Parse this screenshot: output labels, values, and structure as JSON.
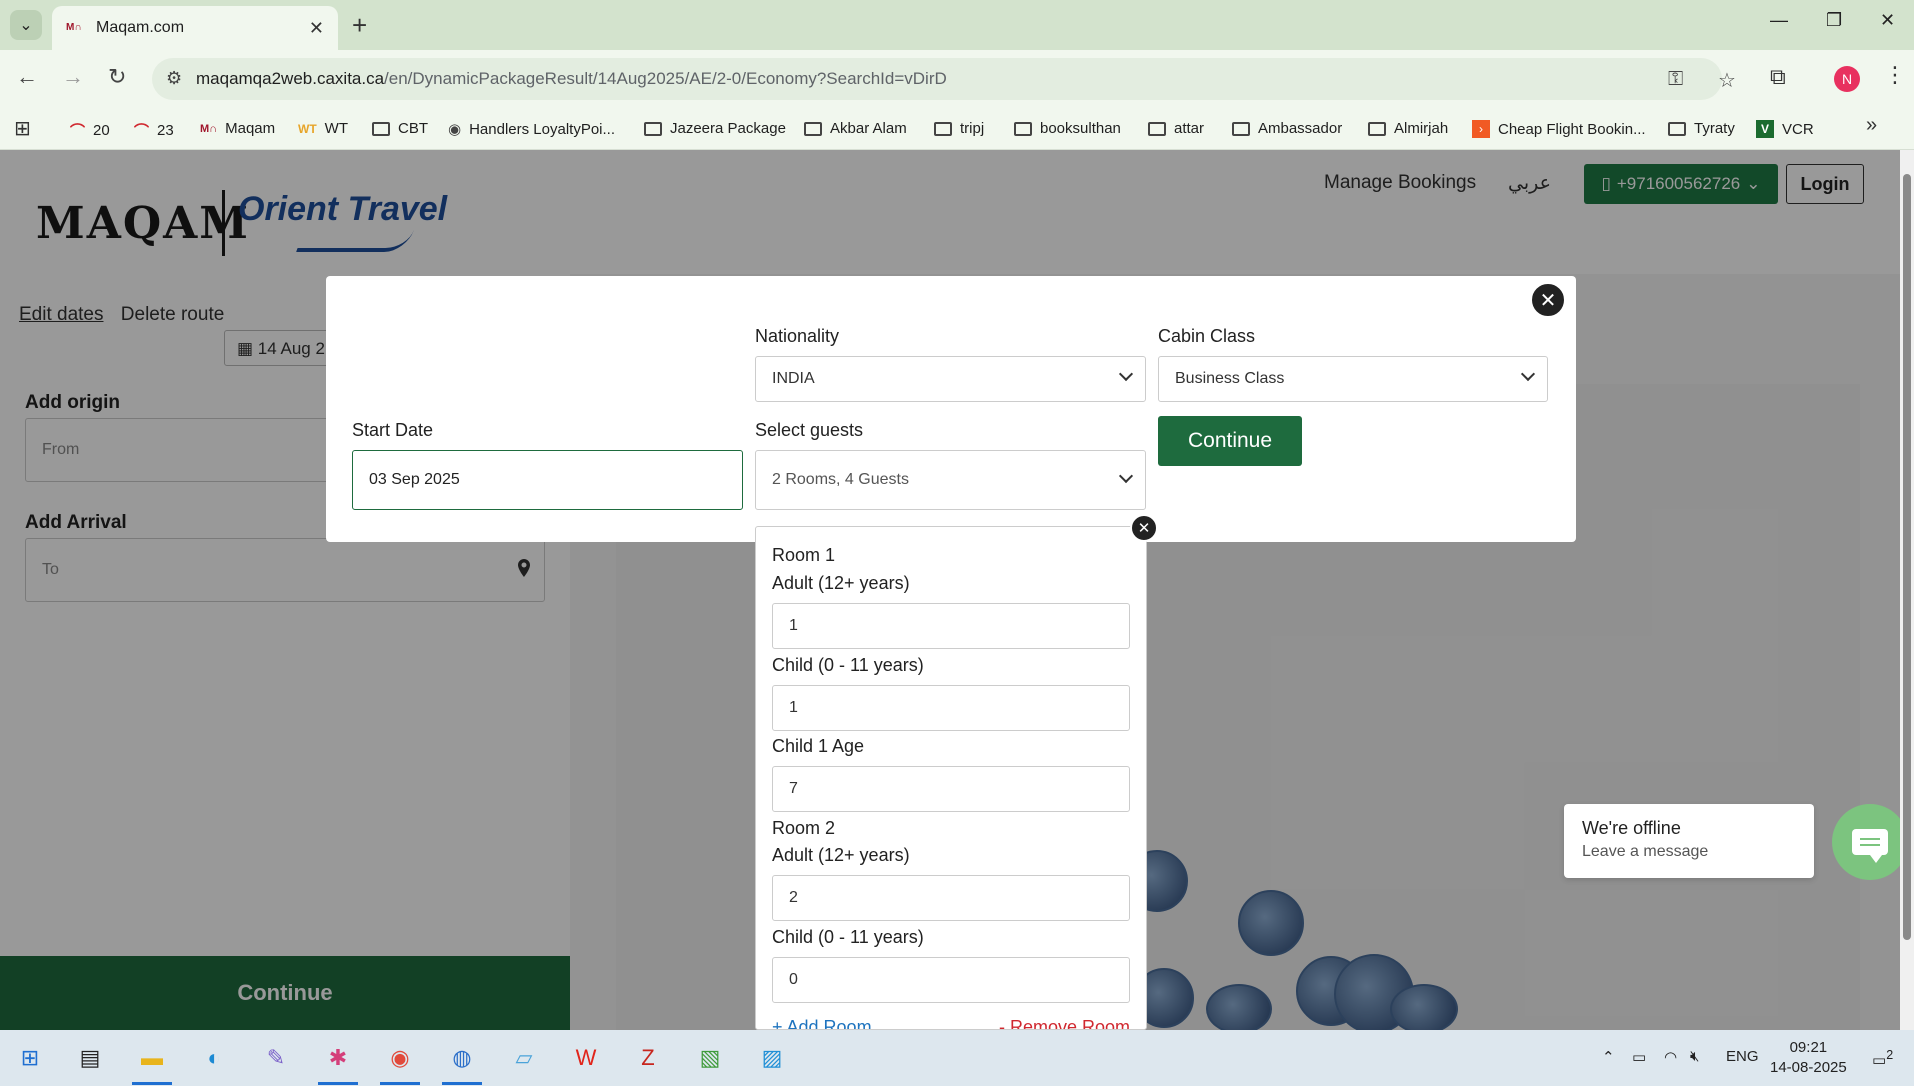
{
  "browser": {
    "tab_title": "Maqam.com",
    "url_host": "maqamqa2web.caxita.ca",
    "url_path": "/en/DynamicPackageResult/14Aug2025/AE/2-0/Economy?SearchId=vDirD",
    "bookmarks": [
      {
        "label": "20",
        "icon": "gauge-icon"
      },
      {
        "label": "23",
        "icon": "gauge-icon"
      },
      {
        "label": "Maqam",
        "icon": "maqam-icon"
      },
      {
        "label": "WT",
        "icon": "wt-icon"
      },
      {
        "label": "CBT",
        "icon": "folder-icon"
      },
      {
        "label": "Handlers LoyaltyPoi...",
        "icon": "globe-icon"
      },
      {
        "label": "Jazeera Package",
        "icon": "folder-icon"
      },
      {
        "label": "Akbar Alam",
        "icon": "folder-icon"
      },
      {
        "label": "tripj",
        "icon": "folder-icon"
      },
      {
        "label": "booksulthan",
        "icon": "folder-icon"
      },
      {
        "label": "attar",
        "icon": "folder-icon"
      },
      {
        "label": "Ambassador",
        "icon": "folder-icon"
      },
      {
        "label": "Almirjah",
        "icon": "folder-icon"
      },
      {
        "label": "Cheap Flight Bookin...",
        "icon": "flight-icon"
      },
      {
        "label": "Tyraty",
        "icon": "folder-icon"
      },
      {
        "label": "VCR",
        "icon": "vcr-icon"
      }
    ],
    "profile_initial": "N"
  },
  "header": {
    "logo_maqam": "MAQAM",
    "logo_orient": "Orient Travel",
    "manage_bookings": "Manage Bookings",
    "arabic": "عربي",
    "phone": "+971600562726",
    "login": "Login"
  },
  "left_panel": {
    "edit_dates": "Edit dates",
    "delete_route": "Delete route",
    "date_chip": "14 Aug 2",
    "add_origin": "Add origin",
    "from_placeholder": "From",
    "add_arrival": "Add Arrival",
    "to_placeholder": "To",
    "continue": "Continue"
  },
  "modal": {
    "nationality_label": "Nationality",
    "nationality_value": "INDIA",
    "cabin_label": "Cabin Class",
    "cabin_value": "Business Class",
    "start_date_label": "Start Date",
    "start_date_value": "03 Sep 2025",
    "guests_label": "Select guests",
    "guests_value": "2 Rooms, 4 Guests",
    "continue": "Continue"
  },
  "guests": {
    "room1": {
      "title": "Room 1",
      "adult_label": "Adult (12+ years)",
      "adult_value": "1",
      "child_label": "Child (0 - 11 years)",
      "child_value": "1",
      "child1_age_label": "Child 1 Age",
      "child1_age_value": "7"
    },
    "room2": {
      "title": "Room 2",
      "adult_label": "Adult (12+ years)",
      "adult_value": "2",
      "child_label": "Child (0 - 11 years)",
      "child_value": "0"
    },
    "add_room": "+ Add Room",
    "remove_room": "- Remove Room"
  },
  "chat": {
    "title": "We're offline",
    "subtitle": "Leave a message"
  },
  "taskbar": {
    "lang": "ENG",
    "time": "09:21",
    "date": "14-08-2025",
    "notifications": "2"
  }
}
